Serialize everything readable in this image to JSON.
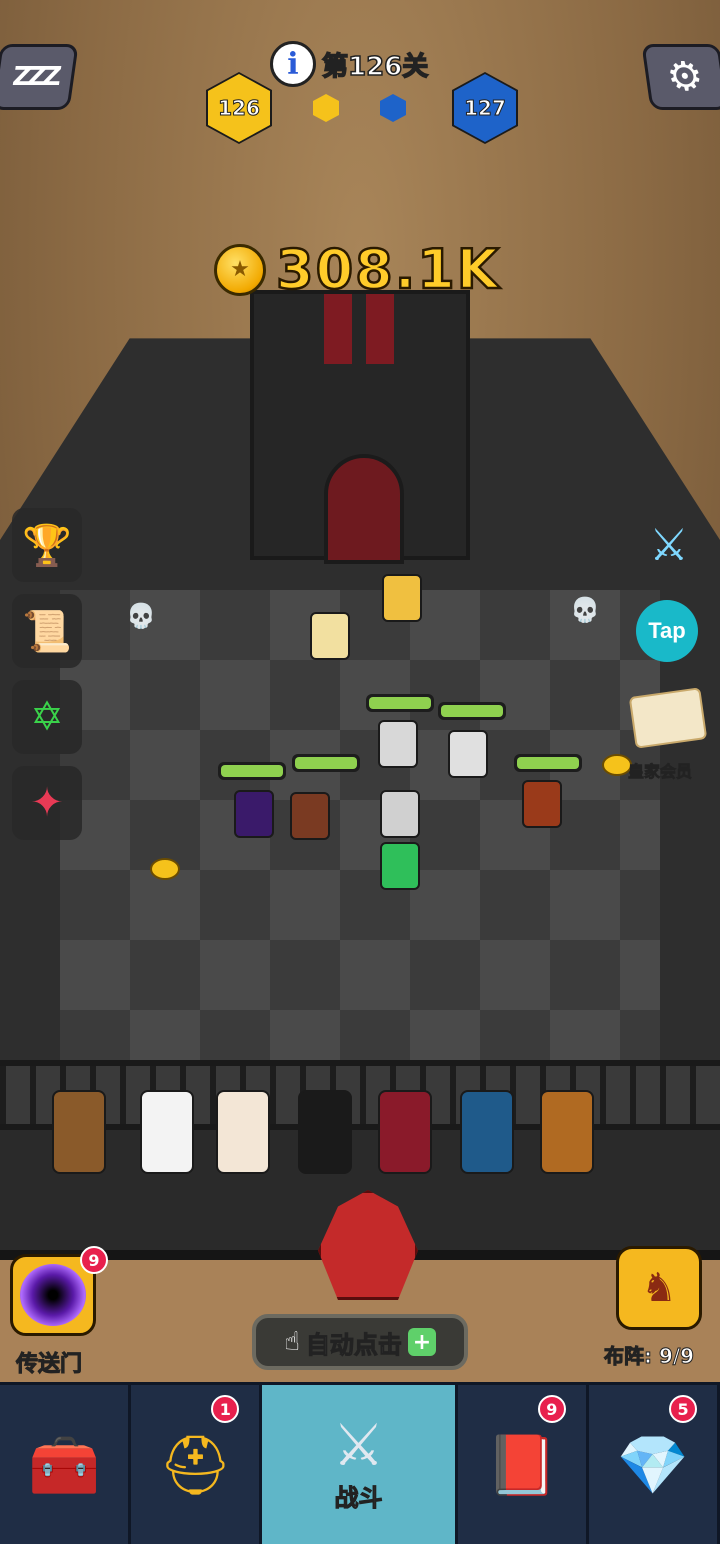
{
  "hud": {
    "level_title": "第126关",
    "current_level": "126",
    "next_level": "127",
    "coins": "308.1K",
    "colors": {
      "current_hex": "#f5c21b",
      "next_hex": "#1e63c9",
      "coin_text": "#ffcc2a"
    }
  },
  "side_menu": {
    "left_items": [
      "rank-trophy-icon",
      "scroll-map-icon",
      "hexagram-icon",
      "red-crest-icon"
    ],
    "right_tap_label": "Tap",
    "right_vip_label": "皇家会员"
  },
  "actions": {
    "portal_label": "传送门",
    "portal_badge": "9",
    "auto_click_label": "自动点击",
    "formation_label": "布阵: 9/9"
  },
  "tabs": [
    {
      "icon": "treasure-chest-icon",
      "label": "",
      "badge": ""
    },
    {
      "icon": "viking-helmet-icon",
      "label": "",
      "badge": "1"
    },
    {
      "icon": "crossed-swords-icon",
      "label": "战斗",
      "badge": "",
      "active": true
    },
    {
      "icon": "spell-book-icon",
      "label": "",
      "badge": "9"
    },
    {
      "icon": "amulet-icon",
      "label": "",
      "badge": "5"
    }
  ]
}
